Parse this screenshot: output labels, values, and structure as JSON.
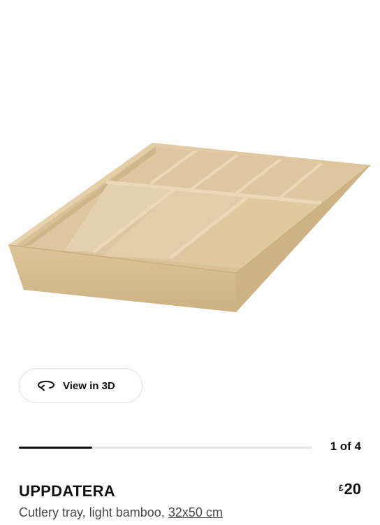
{
  "product": {
    "name": "UPPDATERA",
    "currency": "£",
    "price": "20",
    "description_prefix": "Cutlery tray, light bamboo,",
    "size_link": "32x50 cm",
    "image_icon": "cutlery-tray-image"
  },
  "view3d": {
    "label": "View in 3D",
    "icon": "rotate-3d-icon"
  },
  "gallery": {
    "counter": "1 of 4",
    "current": 1,
    "total": 4
  },
  "colors": {
    "bamboo": "#d7bf94",
    "text": "#111111",
    "muted": "#484848"
  }
}
